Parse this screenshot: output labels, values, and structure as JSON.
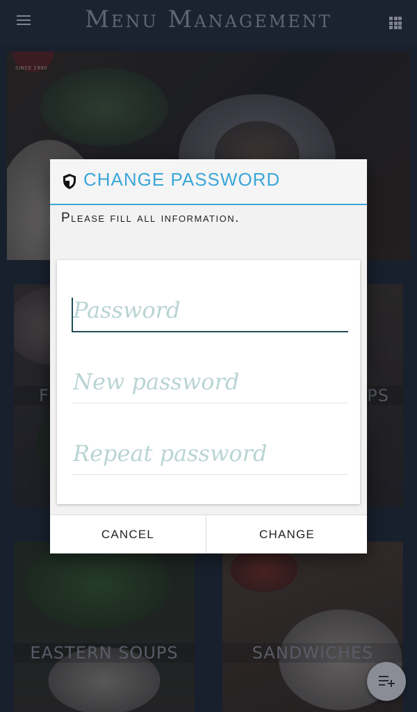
{
  "app": {
    "title": "Menu Management"
  },
  "hero": {
    "logo_text": "SINCE 1990"
  },
  "categories": [
    {
      "label": "F"
    },
    {
      "label": "PS"
    },
    {
      "label": "EASTERN SOUPS"
    },
    {
      "label": "SANDWICHES"
    }
  ],
  "dialog": {
    "icon": "shield-icon",
    "title": "CHANGE PASSWORD",
    "subtitle": "Please fill all information.",
    "fields": [
      {
        "placeholder": "Password",
        "value": ""
      },
      {
        "placeholder": "New password",
        "value": ""
      },
      {
        "placeholder": "Repeat password",
        "value": ""
      }
    ],
    "cancel_label": "CANCEL",
    "change_label": "CHANGE"
  },
  "colors": {
    "accent": "#3aa6d8",
    "field_focus": "#1f4c53",
    "placeholder": "#b9d4d3"
  }
}
